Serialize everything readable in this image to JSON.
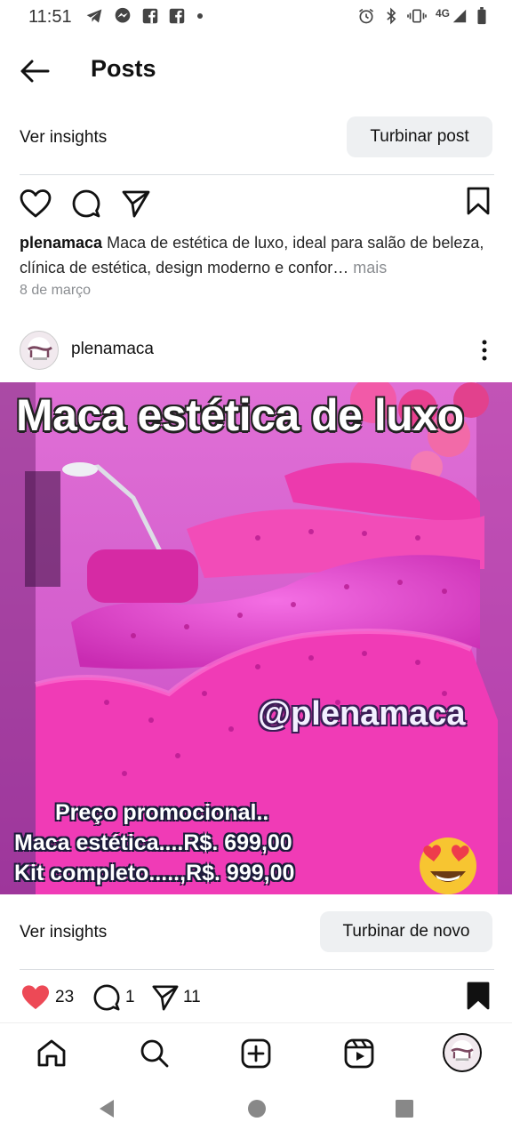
{
  "status_bar": {
    "time": "11:51",
    "network": "4G",
    "left_icons": [
      "telegram-icon",
      "messenger-icon",
      "facebook-icon",
      "facebook-icon",
      "dot-icon"
    ],
    "right_icons": [
      "alarm-icon",
      "bluetooth-icon",
      "vibrate-icon",
      "signal-icon",
      "battery-icon"
    ]
  },
  "header": {
    "title": "Posts"
  },
  "insights_top": {
    "label": "Ver insights",
    "button": "Turbinar post"
  },
  "prev_post": {
    "account": "plenamaca",
    "caption": "Maca de estética de luxo, ideal para salão de beleza, clínica de estética, design moderno e confor…",
    "more": "mais",
    "date": "8 de março"
  },
  "post": {
    "account": "plenamaca",
    "image": {
      "title": "Maca estética de luxo",
      "handle": "@plenamaca",
      "promo": "Preço promocional..",
      "line1": "Maca estética....R$.  699,00",
      "line2": "Kit completo.....,R$.   999,00",
      "emoji": "heart-eyes-emoji"
    }
  },
  "insights_bottom": {
    "label": "Ver insights",
    "button": "Turbinar de novo"
  },
  "actions": {
    "likes": "23",
    "comments": "1",
    "shares": "11",
    "like_color": "#ed4956"
  },
  "bottom_nav": [
    "home-icon",
    "search-icon",
    "create-icon",
    "reels-icon",
    "profile-avatar"
  ],
  "system_nav": [
    "back-icon",
    "home-circle-icon",
    "recents-icon"
  ]
}
